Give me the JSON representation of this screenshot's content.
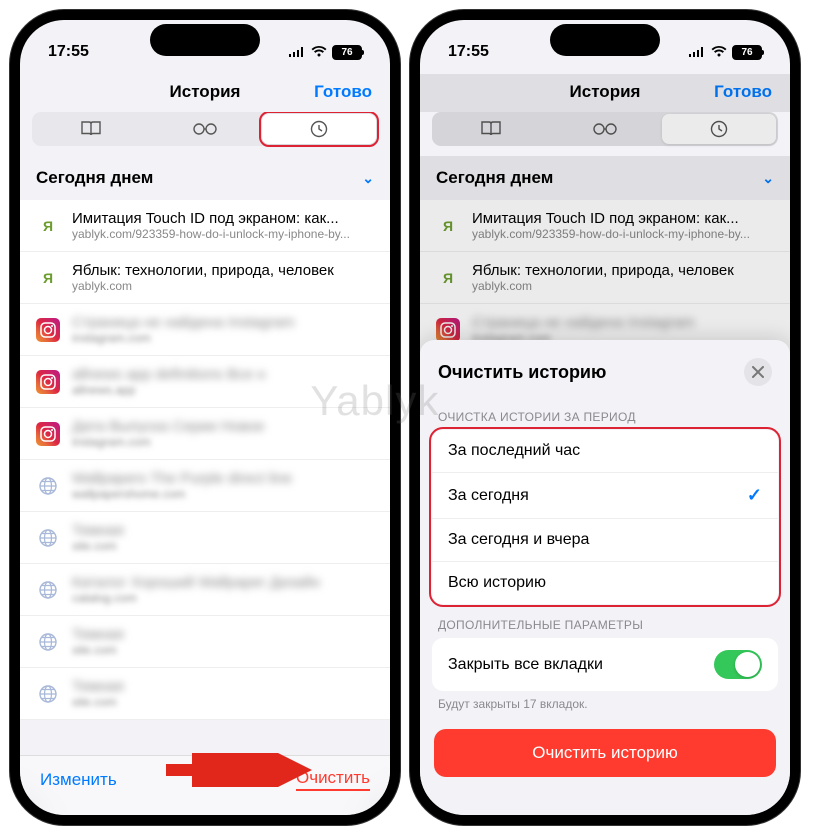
{
  "watermark": "Yablyk",
  "status": {
    "time": "17:55",
    "battery": "76"
  },
  "nav": {
    "title": "История",
    "done": "Готово"
  },
  "section_header": "Сегодня днем",
  "history": [
    {
      "favicon": "y",
      "title": "Имитация Touch ID под экраном: как...",
      "sub": "yablyk.com/923359-how-do-i-unlock-my-iphone-by..."
    },
    {
      "favicon": "y",
      "title": "Яблык: технологии, природа, человек",
      "sub": "yablyk.com"
    },
    {
      "favicon": "ig",
      "title": "Страница не найдена Instagram",
      "sub": "instagram.com",
      "blur": true
    },
    {
      "favicon": "ig",
      "title": "allnews app definitions Все н",
      "sub": "allnews.app",
      "blur": true
    },
    {
      "favicon": "ig",
      "title": "Дата Выпуска Серии Новое",
      "sub": "instagram.com",
      "blur": true
    },
    {
      "favicon": "globe",
      "title": "Wallpapers The Purple direct line",
      "sub": "wallpapershome.com",
      "blur": true
    },
    {
      "favicon": "globe",
      "title": "Темная",
      "sub": "site.com",
      "blur": true
    },
    {
      "favicon": "globe",
      "title": "Каталог Хороший Wallpaper Дизайн",
      "sub": "catalog.com",
      "blur": true
    },
    {
      "favicon": "globe",
      "title": "Темная",
      "sub": "site.com",
      "blur": true
    },
    {
      "favicon": "globe",
      "title": "Темная",
      "sub": "site.com",
      "blur": true
    }
  ],
  "bottombar": {
    "edit": "Изменить",
    "clear": "Очистить"
  },
  "sheet": {
    "title": "Очистить историю",
    "group1_label": "ОЧИСТКА ИСТОРИИ ЗА ПЕРИОД",
    "options": [
      {
        "label": "За последний час"
      },
      {
        "label": "За сегодня",
        "checked": true
      },
      {
        "label": "За сегодня и вчера"
      },
      {
        "label": "Всю историю"
      }
    ],
    "group2_label": "ДОПОЛНИТЕЛЬНЫЕ ПАРАМЕТРЫ",
    "close_tabs_label": "Закрыть все вкладки",
    "hint": "Будут закрыты 17 вкладок.",
    "button": "Очистить историю"
  }
}
